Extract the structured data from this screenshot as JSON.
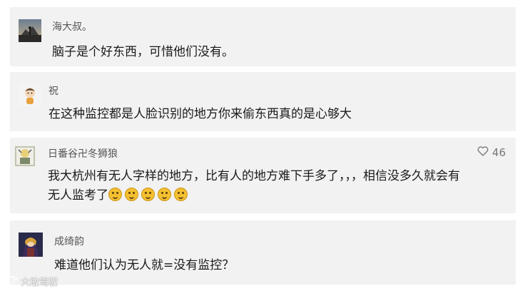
{
  "comments": [
    {
      "username": "海大叔。",
      "text": "脑子是个好东西，可惜他们没有。",
      "avatar_icon": "silhouette-avatar-icon"
    },
    {
      "username": "祝",
      "text": "在这种监控都是人脸识别的地方你来偷东西真的是心够大",
      "avatar_icon": "cartoon-avatar-icon"
    },
    {
      "username": "日番谷卍冬狮狼",
      "text_line1": "我大杭州有无人字样的地方，比有人的地方难下手多了，，，相信没多久就会有",
      "text_line2": "无人监考了",
      "emoji_count": 5,
      "emoji_icon": "laugh-emoji-icon",
      "likes": "46",
      "like_icon": "heart-outline-icon"
    },
    {
      "username": "成绮韵",
      "text": "难道他们认为无人就=没有监控？",
      "avatar_icon": "anime-avatar-icon"
    }
  ],
  "watermark": {
    "text": "大敢驾驭",
    "icon": "watermark-logo-icon"
  }
}
